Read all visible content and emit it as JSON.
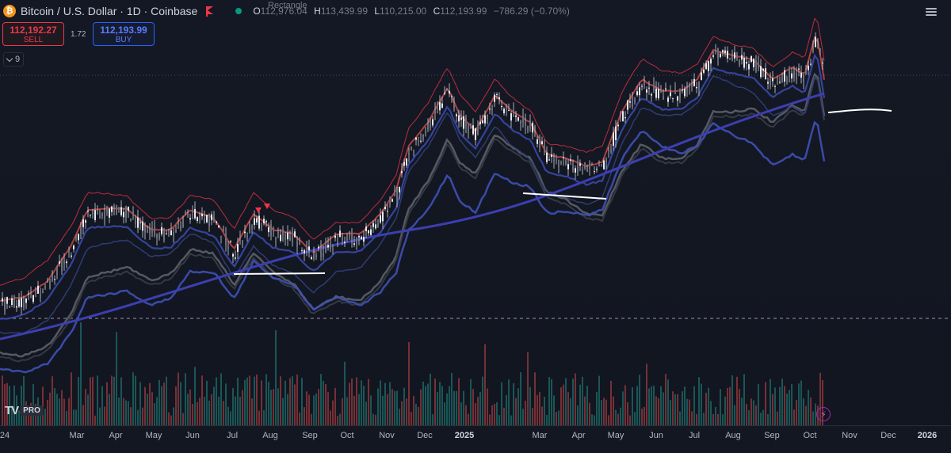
{
  "header": {
    "coin_glyph": "₿",
    "symbol_title": "Bitcoin / U.S. Dollar · 1D · Coinbase",
    "ohlc": {
      "o_label": "O",
      "o_value": "112,976.04",
      "h_label": "H",
      "h_value": "113,439.99",
      "l_label": "L",
      "l_value": "110,215.00",
      "c_label": "C",
      "c_value": "112,193.99",
      "change": "−786.29 (−0.70%)"
    },
    "drawing_label": "Rectangle"
  },
  "trade": {
    "sell_price": "112,192.27",
    "sell_label": "SELL",
    "spread": "1.72",
    "buy_price": "112,193.99",
    "buy_label": "BUY"
  },
  "indicators_toggle": {
    "count": "9"
  },
  "colors": {
    "background": "#131722",
    "up_candle": "#d1d4dc",
    "down_candle": "#d1d4dc",
    "upper_band": "#f23645",
    "lower_band": "#3f51b5",
    "sma": "#3c3fb0",
    "gray_band": "#5d6068",
    "volume_up": "#26a69a",
    "volume_down": "#ef5350",
    "support_line": "#ffffff"
  },
  "x_axis": {
    "ticks": [
      {
        "label": "24",
        "bold": false
      },
      {
        "label": "Mar",
        "bold": false
      },
      {
        "label": "Apr",
        "bold": false
      },
      {
        "label": "May",
        "bold": false
      },
      {
        "label": "Jun",
        "bold": false
      },
      {
        "label": "Jul",
        "bold": false
      },
      {
        "label": "Aug",
        "bold": false
      },
      {
        "label": "Sep",
        "bold": false
      },
      {
        "label": "Oct",
        "bold": false
      },
      {
        "label": "Nov",
        "bold": false
      },
      {
        "label": "Dec",
        "bold": false
      },
      {
        "label": "2025",
        "bold": true
      },
      {
        "label": "Mar",
        "bold": false
      },
      {
        "label": "Apr",
        "bold": false
      },
      {
        "label": "May",
        "bold": false
      },
      {
        "label": "Jun",
        "bold": false
      },
      {
        "label": "Jul",
        "bold": false
      },
      {
        "label": "Aug",
        "bold": false
      },
      {
        "label": "Sep",
        "bold": false
      },
      {
        "label": "Oct",
        "bold": false
      },
      {
        "label": "Nov",
        "bold": false
      },
      {
        "label": "Dec",
        "bold": false
      },
      {
        "label": "2026",
        "bold": true
      }
    ]
  },
  "branding": {
    "logo_text": "TV",
    "pro_label": "PRO"
  },
  "chart_data": {
    "type": "candlestick",
    "title": "Bitcoin / U.S. Dollar · 1D · Coinbase",
    "last_close": 112193.99,
    "x": [
      "2024-02",
      "2024-03",
      "2024-04",
      "2024-05",
      "2024-06",
      "2024-07",
      "2024-08",
      "2024-09",
      "2024-10",
      "2024-11",
      "2024-12",
      "2025-01",
      "2025-02",
      "2025-03",
      "2025-04",
      "2025-05",
      "2025-06",
      "2025-07",
      "2025-08",
      "2025-09",
      "2025-10"
    ],
    "series": [
      {
        "name": "",
        "approx_close": [
          51000,
          69000,
          63000,
          67000,
          62000,
          66000,
          59000,
          63000,
          70000,
          96000,
          94000,
          102000,
          84000,
          82000,
          94000,
          104000,
          107000,
          117000,
          109000,
          114000,
          112194
        ]
      }
    ]
  }
}
